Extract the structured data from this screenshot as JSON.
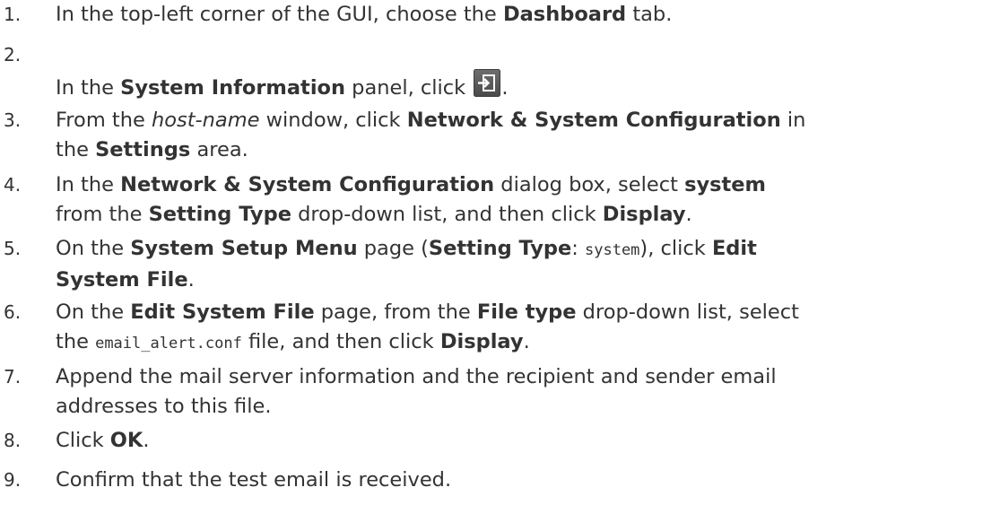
{
  "steps": [
    {
      "number": "1.",
      "parts": [
        "In the top-left corner of the GUI, choose the ",
        "Dashboard",
        " tab."
      ]
    },
    {
      "number": "2.",
      "parts": [
        "In the ",
        "System Information",
        " panel, click ",
        "."
      ],
      "icon": "export-icon"
    },
    {
      "number": "3.",
      "parts": [
        "From the ",
        "host-name",
        " window, click ",
        "Network & System Configuration",
        " in",
        "the ",
        "Settings",
        " area."
      ]
    },
    {
      "number": "4.",
      "parts": [
        "In the ",
        "Network & System Configuration",
        " dialog box, select ",
        "system",
        "from the ",
        "Setting Type",
        " drop-down list, and then click ",
        "Display",
        "."
      ]
    },
    {
      "number": "5.",
      "parts": [
        "On the ",
        "System Setup Menu",
        " page (",
        "Setting Type",
        ": ",
        "system",
        "), click ",
        "Edit",
        "System File",
        "."
      ]
    },
    {
      "number": "6.",
      "parts": [
        "On the ",
        "Edit System File",
        " page, from the ",
        "File type",
        " drop-down list, select",
        "the ",
        "email_alert.conf",
        " file, and then click ",
        "Display",
        "."
      ]
    },
    {
      "number": "7.",
      "parts": [
        "Append the mail server information and the recipient and sender email",
        "addresses to this file."
      ]
    },
    {
      "number": "8.",
      "parts": [
        "Click ",
        "OK",
        "."
      ]
    },
    {
      "number": "9.",
      "parts": [
        "Confirm that the test email is received."
      ]
    }
  ],
  "colors": {
    "text": "#333333",
    "icon_bg": "#5a5a5a",
    "icon_fg": "#ffffff"
  }
}
